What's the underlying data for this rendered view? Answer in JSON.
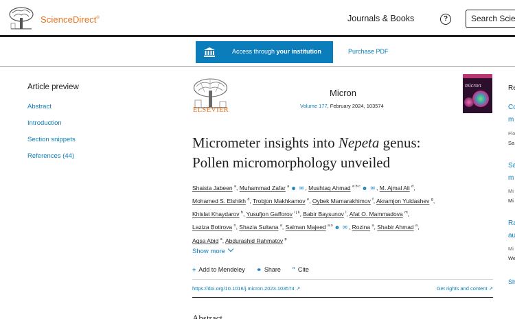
{
  "header": {
    "brand": "ScienceDirect",
    "brand_mark": "®",
    "journals_books": "Journals & Books",
    "help_icon": "question-circle-icon",
    "search_placeholder": "Search Scie"
  },
  "access_bar": {
    "access_prefix": "Access through ",
    "access_bold": "your institution",
    "purchase_pdf": "Purchase PDF"
  },
  "sidebar": {
    "title": "Article preview",
    "items": [
      {
        "label": "Abstract"
      },
      {
        "label": "Introduction"
      },
      {
        "label": "Section snippets"
      },
      {
        "label": "References (44)"
      }
    ]
  },
  "journal": {
    "publisher": "ELSEVIER",
    "title": "Micron",
    "volume_link": "Volume 177",
    "details": ", February 2024, 103574",
    "cover_word": "micron"
  },
  "article": {
    "title_prefix": "Micrometer insights into ",
    "title_italic": "Nepeta",
    "title_suffix": " genus:",
    "title_line2": "Pollen micromorphology unveiled",
    "authors": [
      {
        "name": "Shaista Jabeen",
        "sup": "a"
      },
      {
        "name": "Muhammad Zafar",
        "sup": "a"
      },
      {
        "name": "Mushtaq Ahmad",
        "sup": "a b c"
      },
      {
        "name": "M. Ajmal Ali",
        "sup": "d"
      },
      {
        "name": "Mohamed S. Elshikh",
        "sup": "d"
      },
      {
        "name": "Trobjon Makhkamov",
        "sup": "e"
      },
      {
        "name": "Oybek Mamarakhimov",
        "sup": "f"
      },
      {
        "name": "Akramjon Yuldashev",
        "sup": "g"
      },
      {
        "name": "Khislat Khaydarov",
        "sup": "h"
      },
      {
        "name": "Yusufjon Gafforov",
        "sup": "i j k"
      },
      {
        "name": "Babir Baysunov",
        "sup": "l"
      },
      {
        "name": "Afat O. Mammadova",
        "sup": "m"
      },
      {
        "name": "Laziza Botirova",
        "sup": "n"
      },
      {
        "name": "Shazia Sultana",
        "sup": "a"
      },
      {
        "name": "Salman Majeed",
        "sup": "a o"
      },
      {
        "name": "Rozina",
        "sup": "a"
      },
      {
        "name": "Shabir Ahmad",
        "sup": "a"
      },
      {
        "name": "Aqsa Abid",
        "sup": "a"
      },
      {
        "name": "Abdurashid Rahmatov",
        "sup": "p"
      }
    ],
    "show_more": "Show more",
    "actions": {
      "mendeley": "Add to Mendeley",
      "share": "Share",
      "cite": "Cite"
    },
    "doi": "https://doi.org/10.1016/j.micron.2023.103574",
    "rights": "Get rights and content",
    "abstract_heading": "Abstract"
  },
  "right_column": {
    "heading": "Re",
    "items": [
      {
        "title1": "Co",
        "title2": "m",
        "meta1": "Flo",
        "meta2": "Sa"
      },
      {
        "title1": "Sa",
        "title2": "m",
        "meta1": "Mi",
        "meta2": "Mi"
      },
      {
        "title1": "Ra",
        "title2": "au",
        "meta1": "Mi",
        "meta2": "We"
      }
    ],
    "show": "Sh"
  },
  "colors": {
    "accent_blue": "#0c7dbb",
    "brand_orange": "#e9711c"
  }
}
